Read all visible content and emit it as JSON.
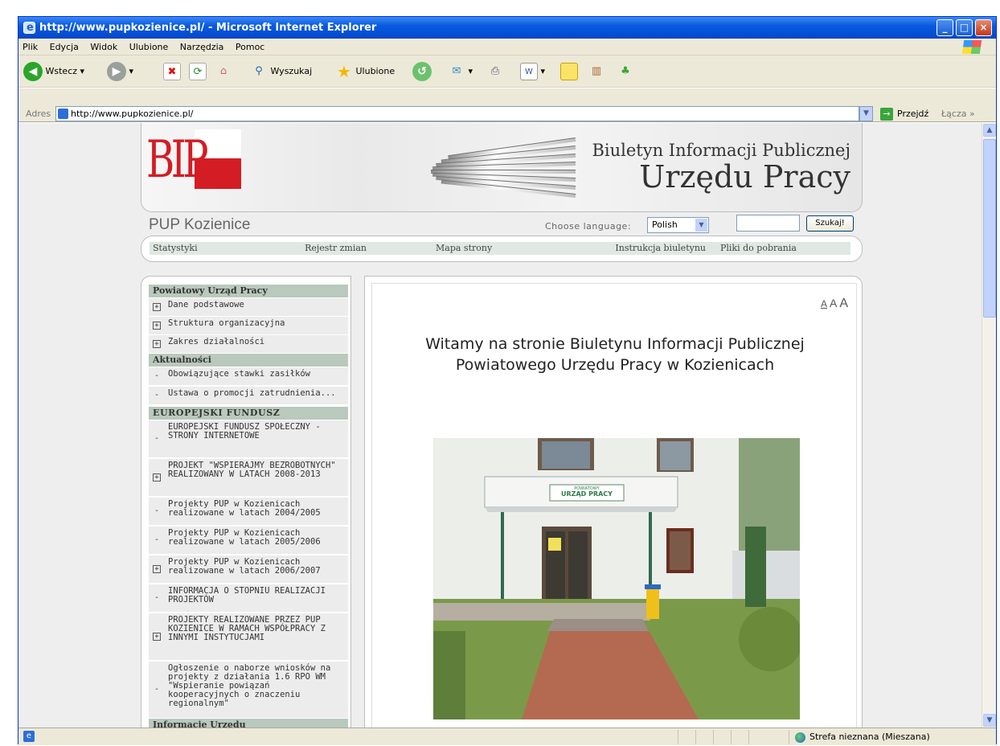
{
  "window": {
    "title": "http://www.pupkozienice.pl/ - Microsoft Internet Explorer",
    "minimize": "_",
    "maximize": "□",
    "close": "×"
  },
  "menu": [
    "Plik",
    "Edycja",
    "Widok",
    "Ulubione",
    "Narzędzia",
    "Pomoc"
  ],
  "toolbar": {
    "back": "Wstecz",
    "search": "Wyszukaj",
    "favorites": "Ulubione"
  },
  "address": {
    "label": "Adres",
    "url": "http://www.pupkozienice.pl/",
    "go": "Przejdź",
    "links": "Łącza"
  },
  "banner": {
    "logo": "BIP",
    "line1": "Biuletyn Informacji Publicznej",
    "line2": "Urzędu Pracy"
  },
  "site": {
    "name": "PUP Kozienice",
    "choose_language": "Choose language:",
    "language": "Polish",
    "search_button": "Szukaj!"
  },
  "nav": [
    "Statystyki",
    "Rejestr zmian",
    "Mapa strony",
    "Instrukcja biuletynu",
    "Pliki do pobrania"
  ],
  "sidebar": {
    "sections": [
      {
        "title": "Powiatowy Urząd Pracy"
      },
      {
        "title": "Aktualności"
      },
      {
        "title": "EUROPEJSKI FUNDUSZ SPOŁECZNY"
      },
      {
        "title": "Informacje Urzędu"
      }
    ],
    "items": [
      {
        "label": "Dane podstawowe",
        "marker": "+"
      },
      {
        "label": "Struktura organizacyjna",
        "marker": "+"
      },
      {
        "label": "Zakres działalności",
        "marker": "+"
      },
      {
        "label": "Obowiązujące stawki zasiłków",
        "marker": "-"
      },
      {
        "label": "Ustawa o promocji zatrudnienia...",
        "marker": "-"
      },
      {
        "label": "EUROPEJSKI FUNDUSZ SPOŁECZNY - STRONY INTERNETOWE",
        "marker": "-"
      },
      {
        "label": "PROJEKT \"WSPIERAJMY BEZROBOTNYCH\" REALIZOWANY W LATACH 2008-2013",
        "marker": "+"
      },
      {
        "label": "Projekty PUP w Kozienicach realizowane w latach 2004/2005",
        "marker": "-"
      },
      {
        "label": "Projekty PUP w Kozienicach realizowane w latach 2005/2006",
        "marker": "-"
      },
      {
        "label": "Projekty PUP w Kozienicach realizowane w latach 2006/2007",
        "marker": "+"
      },
      {
        "label": "INFORMACJA O STOPNIU REALIZACJI PROJEKTÓW",
        "marker": "-"
      },
      {
        "label": "PROJEKTY REALIZOWANE PRZEZ PUP KOZIENICE W RAMACH WSPÓŁPRACY Z INNYMI INSTYTUCJAMI",
        "marker": "+"
      },
      {
        "label": "Ogłoszenie o naborze wniosków na projekty z działania 1.6 RPO WM \"Wspieranie powiązań kooperacyjnych o znaczeniu regionalnym\"",
        "marker": "-"
      }
    ]
  },
  "content": {
    "font_sizes": [
      "A",
      "A",
      "A"
    ],
    "welcome_line1": "Witamy na stronie Biuletynu Informacji Publicznej",
    "welcome_line2": "Powiatowego Urzędu Pracy w Kozienicach",
    "sign_small": "POWIATOWY",
    "sign": "URZĄD PRACY"
  },
  "status": {
    "zone": "Strefa nieznana (Mieszana)"
  }
}
